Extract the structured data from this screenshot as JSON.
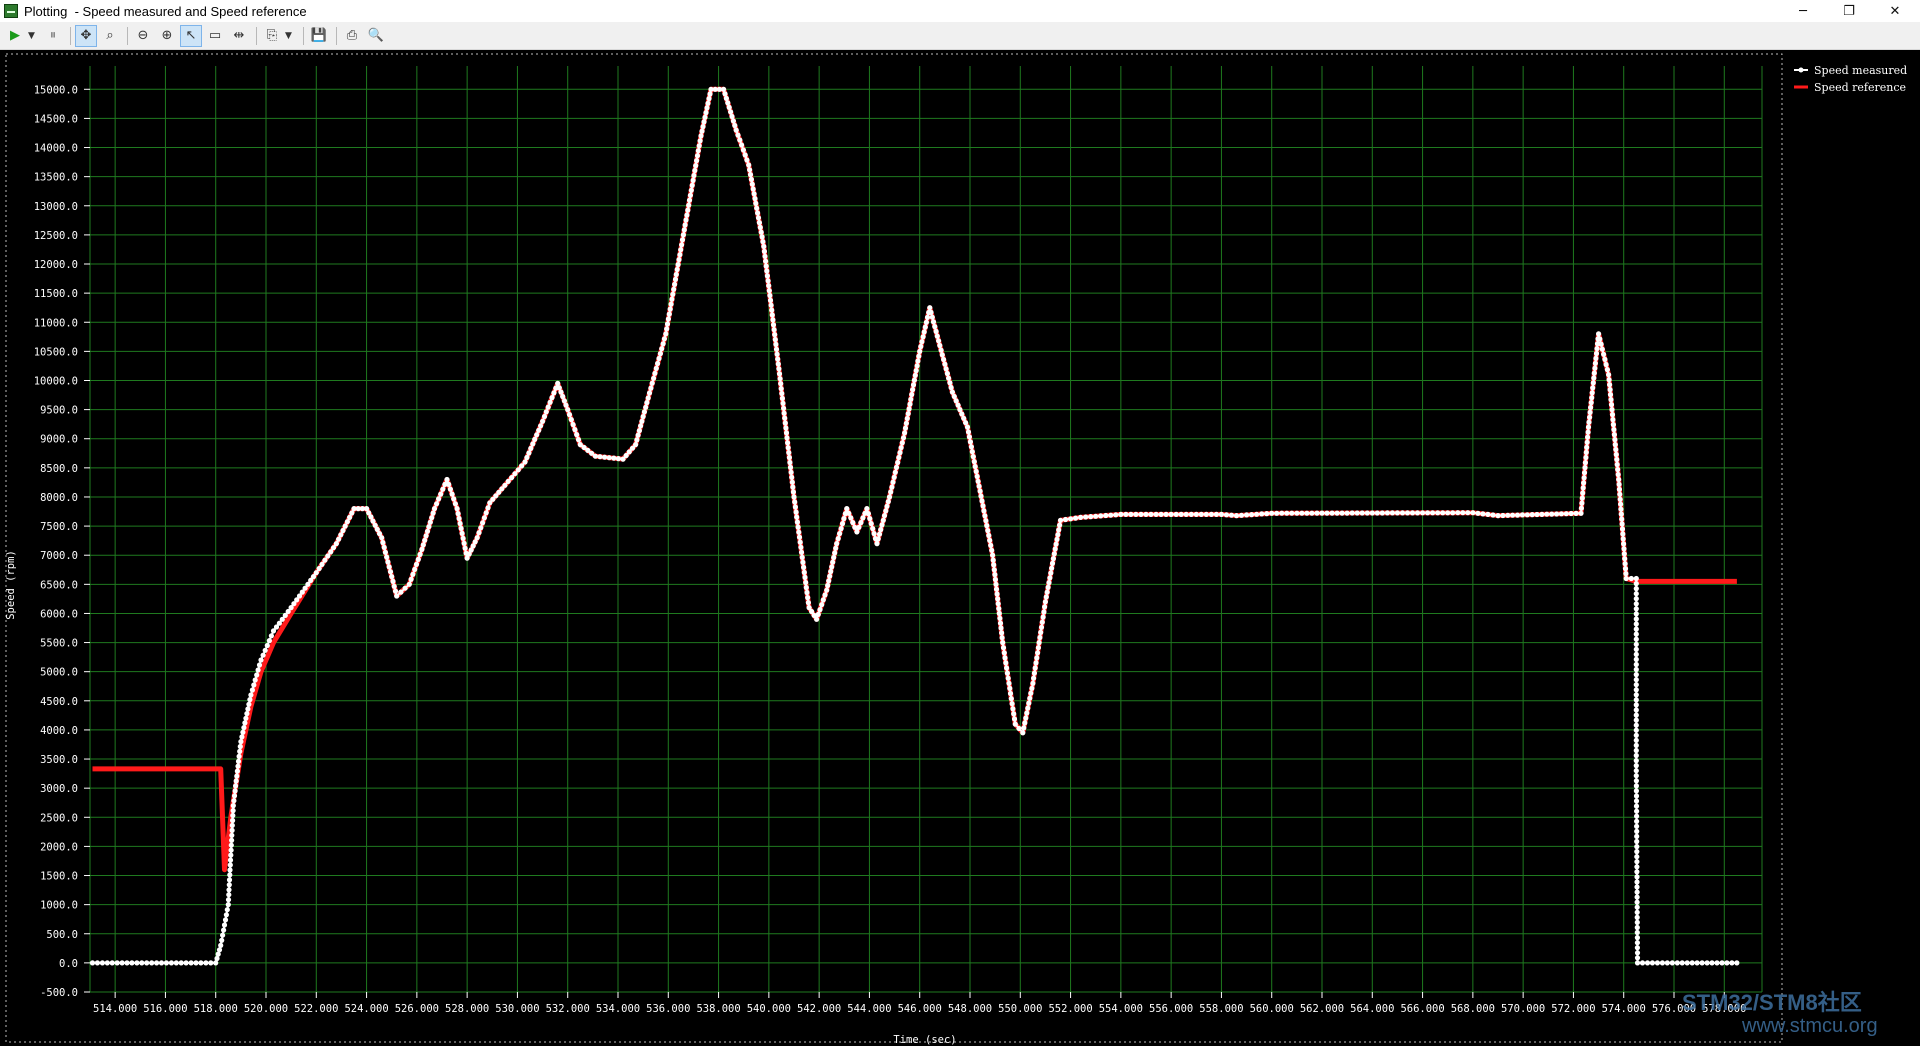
{
  "window": {
    "app_name": "Plotting",
    "title": "Plotting  - Speed measured and Speed reference",
    "controls": {
      "minimize": "─",
      "restore": "❐",
      "close": "✕"
    }
  },
  "toolbar": {
    "buttons": [
      {
        "icon": "play-icon",
        "glyph": "▶"
      },
      {
        "icon": "pause-icon",
        "glyph": "⏸"
      },
      {
        "icon": "pan-icon",
        "glyph": "✥"
      },
      {
        "icon": "zoom-box-icon",
        "glyph": "⌕"
      },
      {
        "icon": "zoom-out-icon",
        "glyph": "⊖"
      },
      {
        "icon": "zoom-in-icon",
        "glyph": "⊕"
      },
      {
        "icon": "select-icon",
        "glyph": "↖"
      },
      {
        "icon": "selection-rect-icon",
        "glyph": "▭"
      },
      {
        "icon": "fit-icon",
        "glyph": "⇹"
      },
      {
        "icon": "copy-icon",
        "glyph": "⎘"
      },
      {
        "icon": "save-icon",
        "glyph": "💾"
      },
      {
        "icon": "print-icon",
        "glyph": "⎙"
      },
      {
        "icon": "print-preview-icon",
        "glyph": "🔍"
      }
    ]
  },
  "colors": {
    "background": "#000000",
    "grid": "#1f7a1f",
    "axis_text": "#ffffff",
    "speed_measured": "#ffffff",
    "speed_reference": "#ff1a1a",
    "watermark": "#3d6e9e"
  },
  "watermark": {
    "line1": "STM32/STM8社区",
    "line2": "www.stmcu.org"
  },
  "chart_data": {
    "type": "line",
    "title": "",
    "xlabel": "Time (sec)",
    "ylabel": "Speed (rpm)",
    "xlim": [
      513.0,
      579.5
    ],
    "ylim": [
      -500,
      15400
    ],
    "x_ticks": [
      514,
      516,
      518,
      520,
      522,
      524,
      526,
      528,
      530,
      532,
      534,
      536,
      538,
      540,
      542,
      544,
      546,
      548,
      550,
      552,
      554,
      556,
      558,
      560,
      562,
      564,
      566,
      568,
      570,
      572,
      574,
      576,
      578
    ],
    "x_tick_labels": [
      "514.000",
      "516.000",
      "518.000",
      "520.000",
      "522.000",
      "524.000",
      "526.000",
      "528.000",
      "530.000",
      "532.000",
      "534.000",
      "536.000",
      "538.000",
      "540.000",
      "542.000",
      "544.000",
      "546.000",
      "548.000",
      "550.000",
      "552.000",
      "554.000",
      "556.000",
      "558.000",
      "560.000",
      "562.000",
      "564.000",
      "566.000",
      "568.000",
      "570.000",
      "572.000",
      "574.000",
      "576.000",
      "578.000"
    ],
    "y_ticks": [
      -500,
      0,
      500,
      1000,
      1500,
      2000,
      2500,
      3000,
      3500,
      4000,
      4500,
      5000,
      5500,
      6000,
      6500,
      7000,
      7500,
      8000,
      8500,
      9000,
      9500,
      10000,
      10500,
      11000,
      11500,
      12000,
      12500,
      13000,
      13500,
      14000,
      14500,
      15000
    ],
    "y_tick_labels": [
      "-500.0",
      "0.0",
      "500.0",
      "1000.0",
      "1500.0",
      "2000.0",
      "2500.0",
      "3000.0",
      "3500.0",
      "4000.0",
      "4500.0",
      "5000.0",
      "5500.0",
      "6000.0",
      "6500.0",
      "7000.0",
      "7500.0",
      "8000.0",
      "8500.0",
      "9000.0",
      "9500.0",
      "10000.0",
      "10500.0",
      "11000.0",
      "11500.0",
      "12000.0",
      "12500.0",
      "13000.0",
      "13500.0",
      "14000.0",
      "14500.0",
      "15000.0"
    ],
    "grid": true,
    "legend_position": "top-right (outside plot)",
    "series": [
      {
        "name": "Speed measured",
        "color": "#ffffff",
        "marker": "dot",
        "points": [
          [
            513.1,
            0
          ],
          [
            518.0,
            0
          ],
          [
            518.2,
            300
          ],
          [
            518.5,
            1000
          ],
          [
            518.7,
            2700
          ],
          [
            519.0,
            3800
          ],
          [
            519.4,
            4600
          ],
          [
            519.8,
            5200
          ],
          [
            520.3,
            5700
          ],
          [
            521.0,
            6100
          ],
          [
            522.0,
            6700
          ],
          [
            522.8,
            7200
          ],
          [
            523.5,
            7800
          ],
          [
            524.0,
            7800
          ],
          [
            524.6,
            7300
          ],
          [
            525.2,
            6300
          ],
          [
            525.7,
            6500
          ],
          [
            526.2,
            7100
          ],
          [
            526.7,
            7800
          ],
          [
            527.2,
            8300
          ],
          [
            527.6,
            7800
          ],
          [
            528.0,
            6950
          ],
          [
            528.4,
            7300
          ],
          [
            528.9,
            7900
          ],
          [
            529.5,
            8200
          ],
          [
            530.3,
            8600
          ],
          [
            531.0,
            9300
          ],
          [
            531.6,
            9950
          ],
          [
            532.0,
            9500
          ],
          [
            532.5,
            8900
          ],
          [
            533.1,
            8700
          ],
          [
            534.2,
            8650
          ],
          [
            534.7,
            8900
          ],
          [
            535.2,
            9700
          ],
          [
            535.9,
            10800
          ],
          [
            536.6,
            12500
          ],
          [
            537.3,
            14200
          ],
          [
            537.7,
            15000
          ],
          [
            538.2,
            15000
          ],
          [
            538.7,
            14300
          ],
          [
            539.2,
            13700
          ],
          [
            539.8,
            12300
          ],
          [
            540.4,
            10200
          ],
          [
            541.0,
            8000
          ],
          [
            541.6,
            6100
          ],
          [
            541.9,
            5900
          ],
          [
            542.3,
            6400
          ],
          [
            542.7,
            7200
          ],
          [
            543.1,
            7800
          ],
          [
            543.5,
            7400
          ],
          [
            543.9,
            7800
          ],
          [
            544.3,
            7200
          ],
          [
            544.8,
            8000
          ],
          [
            545.4,
            9100
          ],
          [
            546.0,
            10500
          ],
          [
            546.4,
            11250
          ],
          [
            546.8,
            10600
          ],
          [
            547.3,
            9800
          ],
          [
            547.9,
            9200
          ],
          [
            548.4,
            8100
          ],
          [
            548.9,
            7000
          ],
          [
            549.3,
            5500
          ],
          [
            549.8,
            4100
          ],
          [
            550.1,
            3950
          ],
          [
            550.5,
            4800
          ],
          [
            551.0,
            6200
          ],
          [
            551.6,
            7600
          ],
          [
            552.4,
            7650
          ],
          [
            554.0,
            7700
          ],
          [
            558.0,
            7700
          ],
          [
            558.6,
            7680
          ],
          [
            560.0,
            7720
          ],
          [
            568.0,
            7730
          ],
          [
            569.0,
            7680
          ],
          [
            572.3,
            7720
          ],
          [
            572.6,
            9200
          ],
          [
            573.0,
            10800
          ],
          [
            573.4,
            10100
          ],
          [
            573.8,
            8300
          ],
          [
            574.1,
            6600
          ],
          [
            574.5,
            6600
          ],
          [
            574.5,
            3300
          ],
          [
            574.55,
            0
          ],
          [
            578.5,
            0
          ]
        ]
      },
      {
        "name": "Speed reference",
        "color": "#ff1a1a",
        "marker": "line",
        "points": [
          [
            513.1,
            3330
          ],
          [
            518.2,
            3330
          ],
          [
            518.35,
            1600
          ],
          [
            518.6,
            2500
          ],
          [
            519.0,
            3600
          ],
          [
            519.4,
            4400
          ],
          [
            519.8,
            5000
          ],
          [
            520.3,
            5500
          ],
          [
            521.0,
            6000
          ],
          [
            522.0,
            6700
          ],
          [
            522.8,
            7200
          ],
          [
            523.5,
            7800
          ],
          [
            524.0,
            7800
          ],
          [
            524.6,
            7300
          ],
          [
            525.2,
            6300
          ],
          [
            525.7,
            6500
          ],
          [
            526.2,
            7100
          ],
          [
            526.7,
            7800
          ],
          [
            527.2,
            8300
          ],
          [
            527.6,
            7800
          ],
          [
            528.0,
            6950
          ],
          [
            528.4,
            7300
          ],
          [
            528.9,
            7900
          ],
          [
            529.5,
            8200
          ],
          [
            530.3,
            8600
          ],
          [
            531.0,
            9300
          ],
          [
            531.6,
            9950
          ],
          [
            532.0,
            9500
          ],
          [
            532.5,
            8900
          ],
          [
            533.1,
            8700
          ],
          [
            534.2,
            8650
          ],
          [
            534.7,
            8900
          ],
          [
            535.2,
            9700
          ],
          [
            535.9,
            10800
          ],
          [
            536.6,
            12500
          ],
          [
            537.3,
            14200
          ],
          [
            537.7,
            15000
          ],
          [
            538.2,
            15000
          ],
          [
            538.7,
            14300
          ],
          [
            539.2,
            13700
          ],
          [
            539.8,
            12300
          ],
          [
            540.4,
            10200
          ],
          [
            541.0,
            8000
          ],
          [
            541.6,
            6100
          ],
          [
            541.9,
            5900
          ],
          [
            542.3,
            6400
          ],
          [
            542.7,
            7200
          ],
          [
            543.1,
            7800
          ],
          [
            543.5,
            7400
          ],
          [
            543.9,
            7800
          ],
          [
            544.3,
            7200
          ],
          [
            544.8,
            8000
          ],
          [
            545.4,
            9100
          ],
          [
            546.0,
            10500
          ],
          [
            546.4,
            11250
          ],
          [
            546.8,
            10600
          ],
          [
            547.3,
            9800
          ],
          [
            547.9,
            9200
          ],
          [
            548.4,
            8100
          ],
          [
            548.9,
            7000
          ],
          [
            549.3,
            5500
          ],
          [
            549.8,
            4100
          ],
          [
            550.1,
            3950
          ],
          [
            550.5,
            4800
          ],
          [
            551.0,
            6200
          ],
          [
            551.6,
            7600
          ],
          [
            552.4,
            7650
          ],
          [
            554.0,
            7700
          ],
          [
            558.0,
            7700
          ],
          [
            558.6,
            7680
          ],
          [
            560.0,
            7720
          ],
          [
            568.0,
            7730
          ],
          [
            569.0,
            7680
          ],
          [
            572.3,
            7720
          ],
          [
            572.6,
            9200
          ],
          [
            573.0,
            10800
          ],
          [
            573.4,
            10100
          ],
          [
            573.8,
            8300
          ],
          [
            574.1,
            6600
          ],
          [
            574.5,
            6550
          ],
          [
            578.5,
            6550
          ]
        ]
      }
    ]
  }
}
